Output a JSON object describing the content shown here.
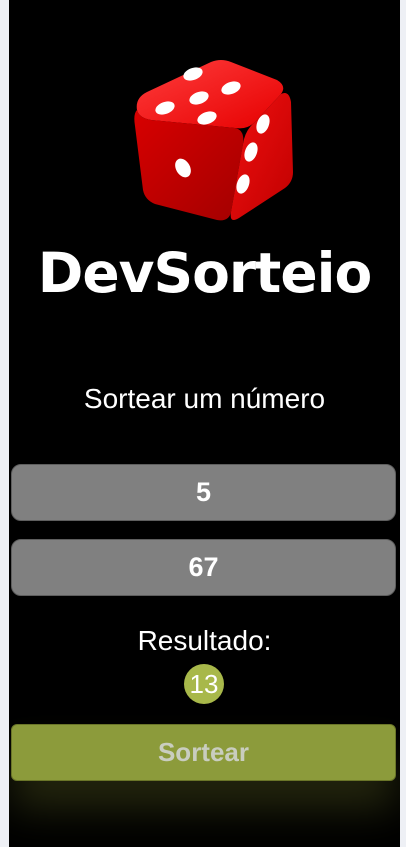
{
  "app": {
    "brand": "DevSorteio",
    "heading": "Sortear um número",
    "logo_icon": "red-dice-icon",
    "accent_color": "#8c9b3b",
    "badge_color": "#a8b84a"
  },
  "form": {
    "min_value": "5",
    "max_value": "67"
  },
  "result": {
    "label": "Resultado:",
    "value": "13"
  },
  "actions": {
    "draw_label": "Sortear"
  }
}
